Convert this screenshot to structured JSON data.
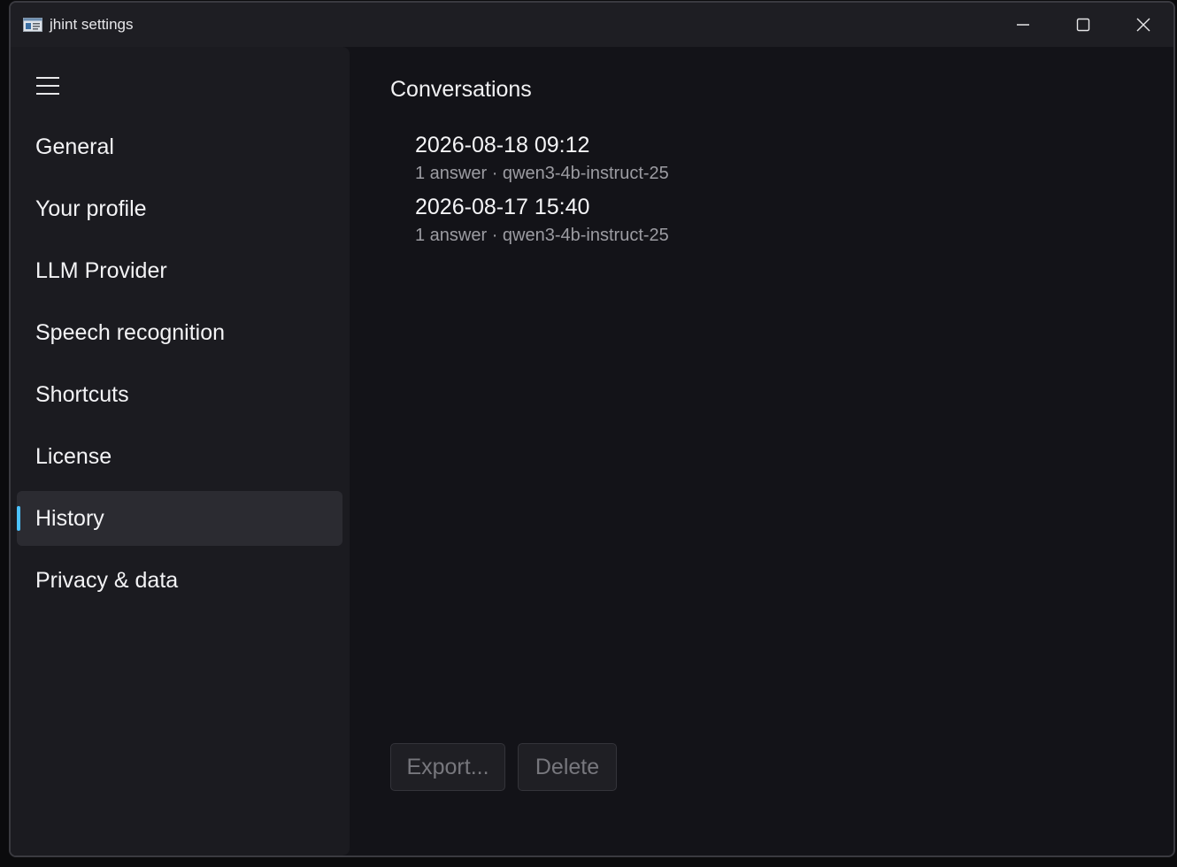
{
  "window": {
    "title": "jhint settings",
    "icon": "app-window-icon"
  },
  "caption": {
    "minimize_icon": "minimize-icon",
    "maximize_icon": "maximize-icon",
    "close_icon": "close-icon"
  },
  "sidebar": {
    "menu_icon": "hamburger-menu-icon",
    "items": [
      {
        "label": "General",
        "selected": false
      },
      {
        "label": "Your profile",
        "selected": false
      },
      {
        "label": "LLM Provider",
        "selected": false
      },
      {
        "label": "Speech recognition",
        "selected": false
      },
      {
        "label": "Shortcuts",
        "selected": false
      },
      {
        "label": "License",
        "selected": false
      },
      {
        "label": "History",
        "selected": true
      },
      {
        "label": "Privacy & data",
        "selected": false
      }
    ]
  },
  "main": {
    "title": "Conversations",
    "conversations": [
      {
        "date": "2026-08-18 09:12",
        "meta": "1 answer · qwen3-4b-instruct-25"
      },
      {
        "date": "2026-08-17 15:40",
        "meta": "1 answer · qwen3-4b-instruct-25"
      }
    ],
    "export_label": "Export...",
    "delete_label": "Delete"
  },
  "colors": {
    "accent": "#4cc2ff",
    "window_bg": "#131318",
    "sidebar_bg": "#1b1b20",
    "selected_bg": "#2b2b31"
  }
}
